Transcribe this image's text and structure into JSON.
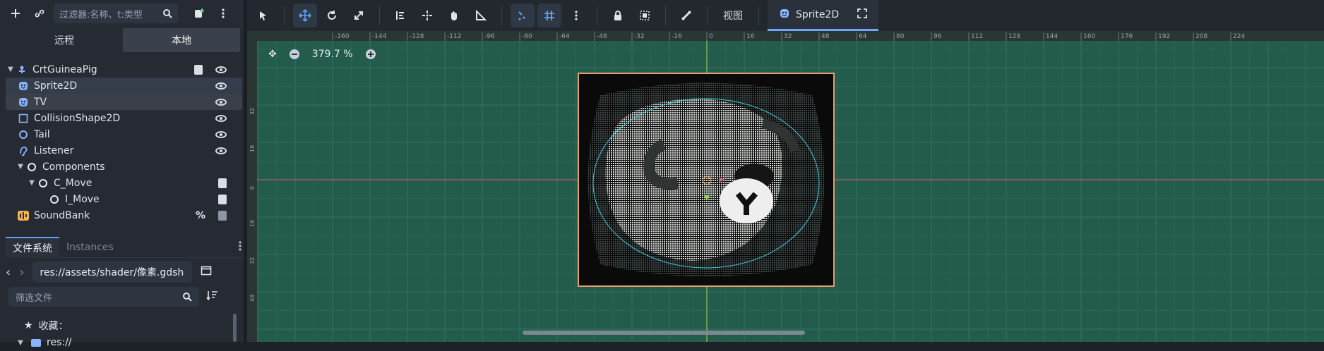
{
  "scene_dock": {
    "filter_placeholder": "过滤器:名称、t:类型",
    "tabs": [
      "远程",
      "本地"
    ],
    "nodes": [
      {
        "name": "CrtGuineaPig",
        "icon": "node2d-icon",
        "level": 0,
        "expanded": true
      },
      {
        "name": "Sprite2D",
        "icon": "sprite2d-icon",
        "level": 1,
        "selected": true
      },
      {
        "name": "TV",
        "icon": "sprite2d-icon",
        "level": 1,
        "hover": true
      },
      {
        "name": "CollisionShape2D",
        "icon": "collision-shape-icon",
        "level": 1
      },
      {
        "name": "Tail",
        "icon": "node-circle-icon",
        "level": 1
      },
      {
        "name": "Listener",
        "icon": "audio-listener-icon",
        "level": 1
      },
      {
        "name": "Components",
        "icon": "node-circle-icon",
        "level": 1,
        "expanded": true
      },
      {
        "name": "C_Move",
        "icon": "node-circle-icon",
        "level": 2,
        "expanded": true
      },
      {
        "name": "I_Move",
        "icon": "node-circle-icon",
        "level": 3
      },
      {
        "name": "SoundBank",
        "icon": "audio-stream-icon",
        "level": 1
      }
    ],
    "soundbank_badge": "%"
  },
  "filesystem_dock": {
    "tabs": [
      "文件系统",
      "Instances"
    ],
    "path": "res://assets/shader/像素.gdsh",
    "filter_placeholder": "筛选文件",
    "favorites_label": "收藏：",
    "root_label": "res://"
  },
  "editor": {
    "view_menu": "视图",
    "tab_label": "Sprite2D",
    "zoom": "379.7 %",
    "ruler_labels": [
      "-160",
      "-144",
      "-128",
      "-112",
      "-96",
      "-80",
      "-64",
      "-48",
      "-32",
      "-16",
      "0",
      "16",
      "32",
      "48",
      "64",
      "80",
      "96",
      "112",
      "128",
      "144",
      "160",
      "176",
      "192",
      "208",
      "224"
    ],
    "left_ruler_labels": [
      "32",
      "16",
      "0",
      "16",
      "32",
      "48"
    ]
  }
}
